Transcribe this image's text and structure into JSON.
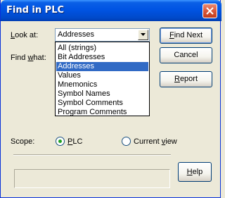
{
  "window": {
    "title": "Find in PLC",
    "close_icon": "close-x-icon"
  },
  "look_at": {
    "label_pre": "",
    "label_ul": "L",
    "label_post": "ook at:",
    "value": "Addresses",
    "arrow_icon": "chevron-down-icon"
  },
  "find_what": {
    "label_pre": "Find ",
    "label_ul": "w",
    "label_post": "hat:"
  },
  "dropdown": {
    "options": [
      "All (strings)",
      "Bit Addresses",
      "Addresses",
      "Values",
      "Mnemonics",
      "Symbol Names",
      "Symbol Comments",
      "Program Comments"
    ],
    "selected": "Addresses",
    "selected_color": "#316ac5"
  },
  "buttons": {
    "find_next_ul": "F",
    "find_next_post": "ind Next",
    "cancel": "Cancel",
    "report_ul": "R",
    "report_post": "eport",
    "help_ul": "H",
    "help_post": "elp"
  },
  "scope": {
    "label": "Scope:",
    "plc_label_ul": "P",
    "plc_label_post": "LC",
    "plc_selected": true,
    "current_view_pre": "Current ",
    "current_view_ul": "v",
    "current_view_post": "iew",
    "current_view_selected": false
  },
  "colors": {
    "titlebar": "#0054e3",
    "dialog_bg": "#ece9d8",
    "radio_dot": "#21a121"
  }
}
